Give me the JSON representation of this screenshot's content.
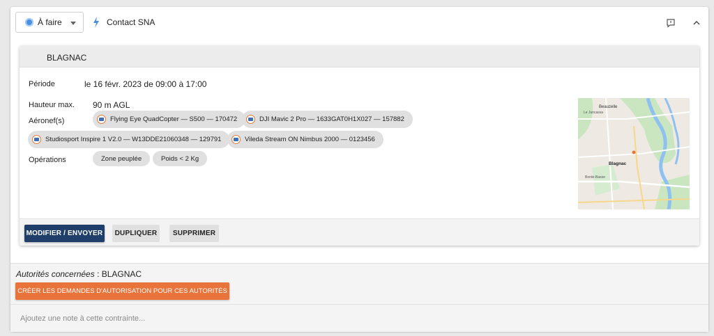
{
  "header": {
    "status_label": "À faire",
    "contact_label": "Contact SNA"
  },
  "card": {
    "title": "BLAGNAC",
    "periode_label": "Période",
    "periode_value": "le 16 févr. 2023 de 09:00 à 17:00",
    "hauteur_label": "Hauteur max.",
    "hauteur_value": "90 m AGL",
    "aeronefs_label": "Aéronef(s)",
    "aeronefs": [
      "Flying Eye QuadCopter — S500 — 170472",
      "DJI Mavic 2 Pro — 1633GAT0H1X027 — 157882",
      "Studiosport Inspire 1 V2.0 — W13DDE21060348 — 129791",
      "Vileda Stream ON Nimbus 2000 — 0123456"
    ],
    "operations_label": "Opérations",
    "operations": [
      "Zone peuplée",
      "Poids < 2 Kg"
    ],
    "map_labels": {
      "beauzelle": "Beauzelle",
      "le_juncassa": "Le Juncassa",
      "blagnac": "Blagnac",
      "borde_basse": "Borde-Basse"
    }
  },
  "actions": {
    "modify": "MODIFIER / ENVOYER",
    "duplicate": "DUPLIQUER",
    "delete": "SUPPRIMER"
  },
  "footer": {
    "authorities_label": "Autorités concernées",
    "authorities_value": " : BLAGNAC",
    "create_requests": "CRÉER LES DEMANDES D'AUTORISATION POUR CES AUTORITÉS",
    "note_placeholder": "Ajoutez une note à cette contrainte..."
  },
  "colors": {
    "primary": "#1f3f6a",
    "accent": "#e8743b",
    "status": "#4a90e2"
  }
}
